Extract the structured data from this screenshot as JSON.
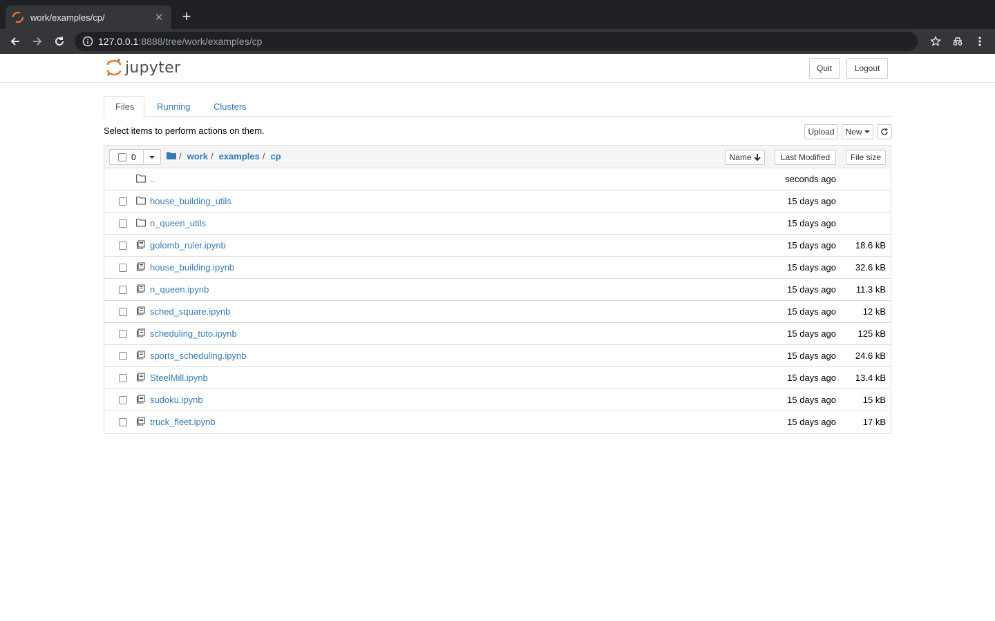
{
  "browser": {
    "tab_title": "work/examples/cp/",
    "url_host": "127.0.0.1",
    "url_path": ":8888/tree/work/examples/cp"
  },
  "header": {
    "logo_text": "jupyter",
    "quit_label": "Quit",
    "logout_label": "Logout"
  },
  "tabs": [
    {
      "label": "Files"
    },
    {
      "label": "Running"
    },
    {
      "label": "Clusters"
    }
  ],
  "actions": {
    "hint": "Select items to perform actions on them.",
    "upload_label": "Upload",
    "new_label": "New"
  },
  "list_header": {
    "selected_count": "0",
    "breadcrumbs": [
      "work",
      "examples",
      "cp"
    ],
    "sort_name_label": "Name",
    "sort_modified_label": "Last Modified",
    "sort_size_label": "File size"
  },
  "parent_row": {
    "name": "..",
    "modified": "seconds ago"
  },
  "files": [
    {
      "type": "folder",
      "name": "house_building_utils",
      "modified": "15 days ago",
      "size": ""
    },
    {
      "type": "folder",
      "name": "n_queen_utils",
      "modified": "15 days ago",
      "size": ""
    },
    {
      "type": "notebook",
      "name": "golomb_ruler.ipynb",
      "modified": "15 days ago",
      "size": "18.6 kB"
    },
    {
      "type": "notebook",
      "name": "house_building.ipynb",
      "modified": "15 days ago",
      "size": "32.6 kB"
    },
    {
      "type": "notebook",
      "name": "n_queen.ipynb",
      "modified": "15 days ago",
      "size": "11.3 kB"
    },
    {
      "type": "notebook",
      "name": "sched_square.ipynb",
      "modified": "15 days ago",
      "size": "12 kB"
    },
    {
      "type": "notebook",
      "name": "scheduling_tuto.ipynb",
      "modified": "15 days ago",
      "size": "125 kB"
    },
    {
      "type": "notebook",
      "name": "sports_scheduling.ipynb",
      "modified": "15 days ago",
      "size": "24.6 kB"
    },
    {
      "type": "notebook",
      "name": "SteelMill.ipynb",
      "modified": "15 days ago",
      "size": "13.4 kB"
    },
    {
      "type": "notebook",
      "name": "sudoku.ipynb",
      "modified": "15 days ago",
      "size": "15 kB"
    },
    {
      "type": "notebook",
      "name": "truck_fleet.ipynb",
      "modified": "15 days ago",
      "size": "17 kB"
    }
  ],
  "colors": {
    "link": "#337ab7",
    "jupyter_orange": "#f37726",
    "chrome_dark": "#202124",
    "chrome_toolbar": "#35363a"
  }
}
